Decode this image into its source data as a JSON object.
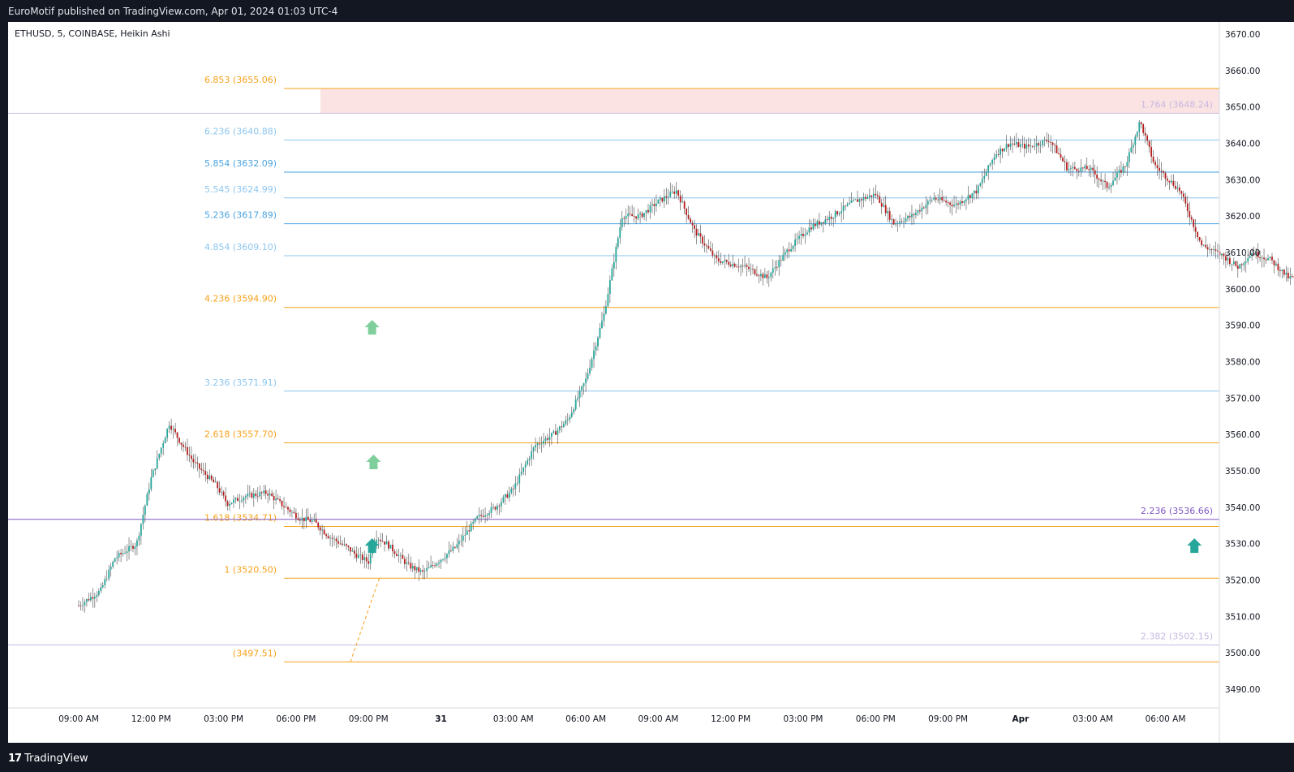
{
  "header": {
    "publish_line": "EuroMotif published on TradingView.com, Apr 01, 2024 01:03 UTC-4"
  },
  "footer": {
    "brand_mark": "17",
    "brand_name": "TradingView"
  },
  "colors": {
    "up": "#26a69a",
    "down": "#b71c1c",
    "wick": "#4a4a4a",
    "fib_orange": "#f7a21b",
    "fib_blue": "#8cc6ef",
    "fib_blue_bold": "#4ba3e0",
    "tz_lilac": "#c7b9e0",
    "tz_purple": "#7e57c2",
    "zone_fill": "#fbe3e3",
    "zone_border": "#e46b2a",
    "arrow_green": "#26a69a",
    "arrow_light": "#7fcf9d"
  },
  "chart_data": {
    "type": "candlestick",
    "title": "ETHUSD, 5, COINBASE, Heikin Ashi",
    "symbol": "ETHUSD",
    "interval": "5",
    "exchange": "COINBASE",
    "candle_style": "Heikin Ashi",
    "ylim": [
      3485,
      3675
    ],
    "y_ticks": [
      "3670.00",
      "3660.00",
      "3650.00",
      "3640.00",
      "3630.00",
      "3620.00",
      "3610.00",
      "3600.00",
      "3590.00",
      "3580.00",
      "3570.00",
      "3560.00",
      "3550.00",
      "3540.00",
      "3530.00",
      "3520.00",
      "3510.00",
      "3500.00",
      "3490.00"
    ],
    "x_ticks": [
      "09:00 AM",
      "12:00 PM",
      "03:00 PM",
      "06:00 PM",
      "09:00 PM",
      "31",
      "03:00 AM",
      "06:00 AM",
      "09:00 AM",
      "12:00 PM",
      "03:00 PM",
      "06:00 PM",
      "09:00 PM",
      "Apr",
      "03:00 AM",
      "06:00 AM"
    ],
    "fib_levels": [
      {
        "label": "6.853 (3655.06)",
        "price": 3655.06,
        "color": "orange"
      },
      {
        "label": "6.236 (3640.88)",
        "price": 3640.88,
        "color": "blue"
      },
      {
        "label": "5.854 (3632.09)",
        "price": 3632.09,
        "color": "blue_bold"
      },
      {
        "label": "5.545 (3624.99)",
        "price": 3624.99,
        "color": "blue"
      },
      {
        "label": "5.236 (3617.89)",
        "price": 3617.89,
        "color": "blue_bold"
      },
      {
        "label": "4.854 (3609.10)",
        "price": 3609.1,
        "color": "blue"
      },
      {
        "label": "4.236 (3594.90)",
        "price": 3594.9,
        "color": "orange"
      },
      {
        "label": "3.236 (3571.91)",
        "price": 3571.91,
        "color": "blue"
      },
      {
        "label": "2.618 (3557.70)",
        "price": 3557.7,
        "color": "orange"
      },
      {
        "label": "1.618 (3534.71)",
        "price": 3534.71,
        "color": "orange"
      },
      {
        "label": "1 (3520.50)",
        "price": 3520.5,
        "color": "orange"
      },
      {
        "label": "(3497.51)",
        "price": 3497.51,
        "color": "orange"
      }
    ],
    "extension_levels": [
      {
        "label": "1.764 (3648.24)",
        "price": 3648.24,
        "color": "lilac"
      },
      {
        "label": "2.236 (3536.66)",
        "price": 3536.66,
        "color": "purple"
      },
      {
        "label": "2.382 (3502.15)",
        "price": 3502.15,
        "color": "lilac"
      }
    ],
    "resistance_zone": {
      "top": 3655.06,
      "bottom": 3648.24
    },
    "up_arrows": [
      {
        "time_index": 4.05,
        "price": 3589,
        "style": "light"
      },
      {
        "time_index": 4.07,
        "price": 3552,
        "style": "light"
      },
      {
        "time_index": 4.05,
        "price": 3529,
        "style": "solid"
      },
      {
        "time_index": 15.4,
        "price": 3529,
        "style": "solid"
      }
    ],
    "series": [
      {
        "name": "ETHUSD",
        "anchors": [
          [
            0,
            3513
          ],
          [
            0.3,
            3517
          ],
          [
            0.5,
            3526
          ],
          [
            0.8,
            3530
          ],
          [
            1.0,
            3548
          ],
          [
            1.25,
            3563
          ],
          [
            1.4,
            3558
          ],
          [
            1.6,
            3552
          ],
          [
            1.9,
            3546
          ],
          [
            2.05,
            3541
          ],
          [
            2.3,
            3543
          ],
          [
            2.6,
            3544
          ],
          [
            2.85,
            3540
          ],
          [
            3.05,
            3537
          ],
          [
            3.25,
            3536
          ],
          [
            3.45,
            3532
          ],
          [
            3.7,
            3529
          ],
          [
            3.82,
            3527
          ],
          [
            4.0,
            3525
          ],
          [
            4.1,
            3532
          ],
          [
            4.25,
            3530
          ],
          [
            4.4,
            3527
          ],
          [
            4.55,
            3524
          ],
          [
            4.75,
            3522
          ],
          [
            4.95,
            3525
          ],
          [
            5.2,
            3529
          ],
          [
            5.5,
            3537
          ],
          [
            5.75,
            3540
          ],
          [
            6.0,
            3545
          ],
          [
            6.15,
            3551
          ],
          [
            6.3,
            3557
          ],
          [
            6.55,
            3560
          ],
          [
            6.75,
            3564
          ],
          [
            7.0,
            3575
          ],
          [
            7.25,
            3593
          ],
          [
            7.5,
            3620
          ],
          [
            7.75,
            3620
          ],
          [
            8.0,
            3624
          ],
          [
            8.25,
            3627
          ],
          [
            8.5,
            3616
          ],
          [
            8.8,
            3608
          ],
          [
            9.2,
            3606
          ],
          [
            9.5,
            3603
          ],
          [
            9.8,
            3611
          ],
          [
            10.1,
            3617
          ],
          [
            10.4,
            3620
          ],
          [
            10.7,
            3624
          ],
          [
            11.0,
            3626
          ],
          [
            11.25,
            3618
          ],
          [
            11.5,
            3620
          ],
          [
            11.8,
            3625
          ],
          [
            12.1,
            3623
          ],
          [
            12.4,
            3627
          ],
          [
            12.65,
            3637
          ],
          [
            12.85,
            3640
          ],
          [
            13.1,
            3639
          ],
          [
            13.4,
            3641
          ],
          [
            13.65,
            3633
          ],
          [
            13.95,
            3633
          ],
          [
            14.2,
            3628
          ],
          [
            14.45,
            3634
          ],
          [
            14.65,
            3646
          ],
          [
            14.85,
            3634
          ],
          [
            15.2,
            3627
          ],
          [
            15.5,
            3612
          ],
          [
            15.8,
            3609
          ],
          [
            16.0,
            3606
          ],
          [
            16.2,
            3610
          ],
          [
            16.45,
            3608
          ],
          [
            16.7,
            3603
          ],
          [
            16.85,
            3603
          ]
        ]
      }
    ]
  }
}
